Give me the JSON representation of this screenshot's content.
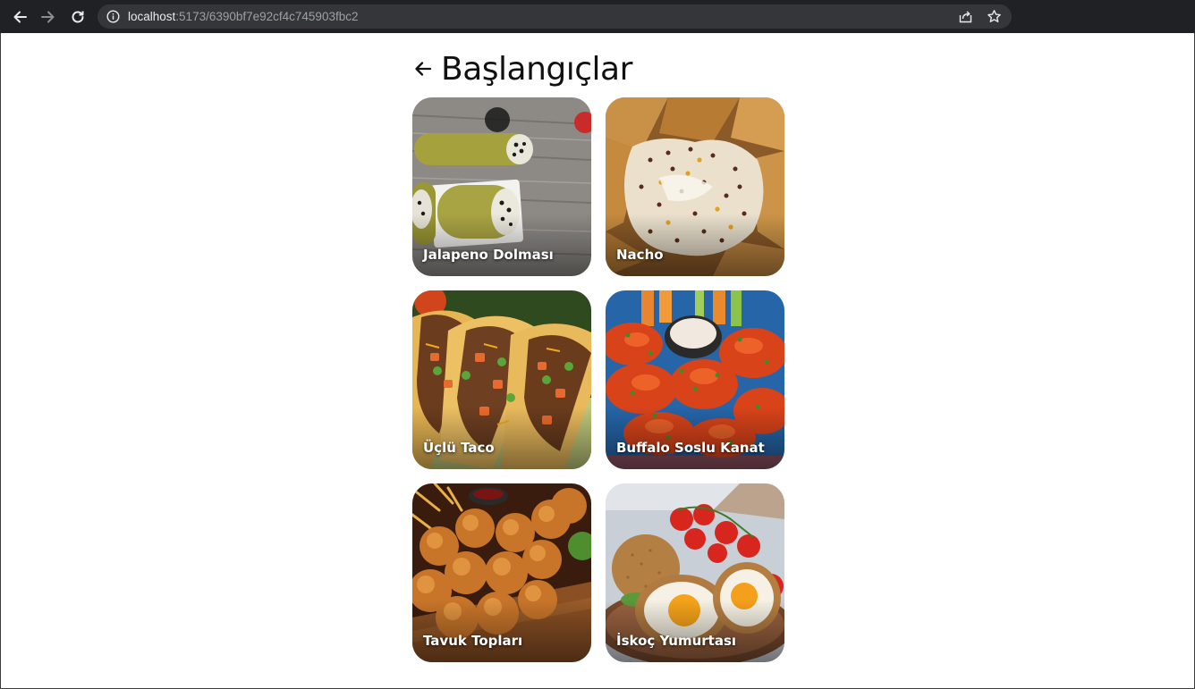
{
  "browser": {
    "url_host": "localhost",
    "url_path": ":5173/6390bf7e92cf4c745903fbc2",
    "icons": [
      "back-arrow-icon",
      "forward-arrow-icon",
      "reload-icon",
      "info-icon",
      "share-icon",
      "star-icon"
    ]
  },
  "page": {
    "title": "Başlangıçlar",
    "back_icon": "arrow-left-icon"
  },
  "items": [
    {
      "label": "Jalapeno Dolması"
    },
    {
      "label": "Nacho"
    },
    {
      "label": "Üçlü Taco"
    },
    {
      "label": "Buffalo Soslu Kanat"
    },
    {
      "label": "Tavuk Topları"
    },
    {
      "label": "İskoç Yumurtası"
    }
  ]
}
